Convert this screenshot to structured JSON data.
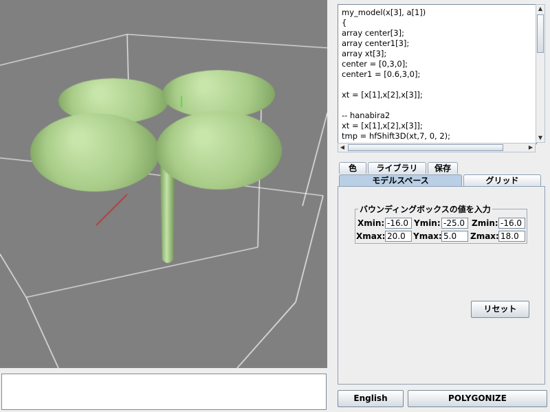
{
  "code_editor": {
    "text": "my_model(x[3], a[1])\n{\narray center[3];\narray center1[3];\narray xt[3];\ncenter = [0,3,0];\ncenter1 = [0.6,3,0];\n\nxt = [x[1],x[2],x[3]];\n\n-- hanabira2\nxt = [x[1],x[2],x[3]];\ntmp = hfShift3D(xt,7, 0, 2);"
  },
  "tabs_row1": [
    {
      "label": "色"
    },
    {
      "label": "ライブラリ"
    },
    {
      "label": "保存"
    }
  ],
  "tabs_row2": [
    {
      "label": "モデルスペース"
    },
    {
      "label": "グリッド"
    }
  ],
  "bounding_box": {
    "legend": "バウンディングボックスの値を入力",
    "xmin_label": "Xmin:",
    "xmin": "-16.0",
    "ymin_label": "Ymin:",
    "ymin": "-25.0",
    "zmin_label": "Zmin:",
    "zmin": "-16.0",
    "xmax_label": "Xmax:",
    "xmax": "20.0",
    "ymax_label": "Ymax:",
    "ymax": "5.0",
    "zmax_label": "Zmax:",
    "zmax": "18.0"
  },
  "buttons": {
    "reset": "リセット",
    "english": "English",
    "polygonize": "POLYGONIZE"
  },
  "colors": {
    "viewport_bg": "#808080",
    "model_green": "#a8cc88",
    "selected_tab": "#b8cfe5"
  }
}
